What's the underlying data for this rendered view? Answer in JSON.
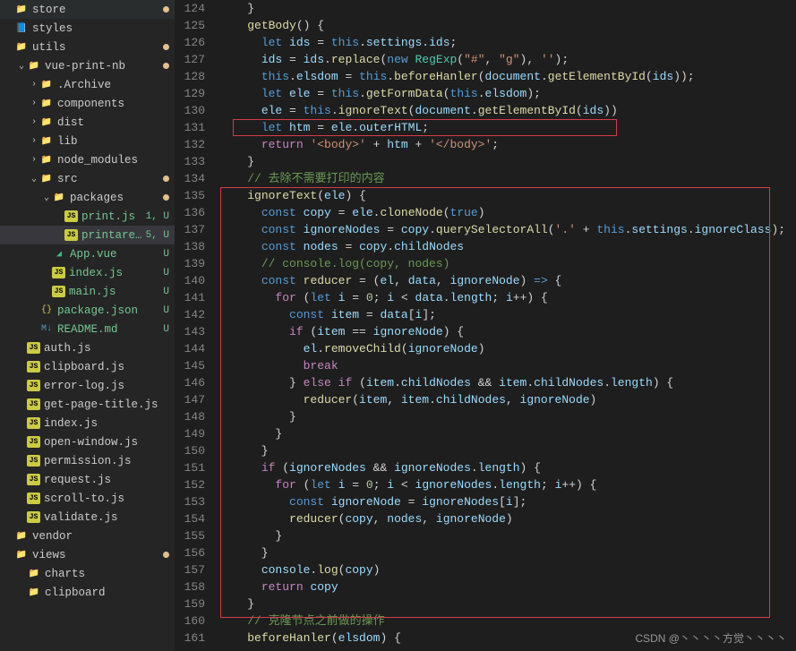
{
  "sidebar": [
    {
      "indent": 0,
      "chev": "",
      "icon": "folder",
      "iconClass": "folder-icon",
      "label": "store",
      "dot": true,
      "name": "folder-store"
    },
    {
      "indent": 0,
      "chev": "",
      "icon": "styles",
      "iconClass": "folder-blue",
      "label": "styles",
      "name": "folder-styles"
    },
    {
      "indent": 0,
      "chev": "",
      "icon": "folder",
      "iconClass": "folder-red",
      "label": "utils",
      "dot": true,
      "name": "folder-utils"
    },
    {
      "indent": 1,
      "chev": "v",
      "icon": "folder",
      "iconClass": "folder-orange",
      "label": "vue-print-nb",
      "dot": true,
      "name": "folder-vue-print-nb"
    },
    {
      "indent": 2,
      "chev": ">",
      "icon": "folder",
      "iconClass": "folder-icon",
      "label": ".Archive",
      "name": "folder-archive"
    },
    {
      "indent": 2,
      "chev": ">",
      "icon": "folder",
      "iconClass": "folder-green",
      "label": "components",
      "name": "folder-components"
    },
    {
      "indent": 2,
      "chev": ">",
      "icon": "folder",
      "iconClass": "folder-icon",
      "label": "dist",
      "name": "folder-dist"
    },
    {
      "indent": 2,
      "chev": ">",
      "icon": "folder",
      "iconClass": "folder-icon",
      "label": "lib",
      "name": "folder-lib"
    },
    {
      "indent": 2,
      "chev": ">",
      "icon": "folder",
      "iconClass": "folder-green",
      "label": "node_modules",
      "name": "folder-node-modules"
    },
    {
      "indent": 2,
      "chev": "v",
      "icon": "folder",
      "iconClass": "folder-green",
      "label": "src",
      "dot": true,
      "name": "folder-src"
    },
    {
      "indent": 3,
      "chev": "v",
      "icon": "folder",
      "iconClass": "folder-orange",
      "label": "packages",
      "dot": true,
      "name": "folder-packages"
    },
    {
      "indent": 4,
      "chev": "",
      "icon": "JS",
      "iconClass": "js-icon",
      "label": "print.js",
      "status": "1, U",
      "statusClass": "u",
      "name": "file-print-js"
    },
    {
      "indent": 4,
      "chev": "",
      "icon": "JS",
      "iconClass": "js-icon",
      "label": "printarea.js",
      "status": "5, U",
      "statusClass": "u",
      "active": true,
      "name": "file-printarea-js"
    },
    {
      "indent": 3,
      "chev": "",
      "icon": "V",
      "iconClass": "vue-icon",
      "label": "App.vue",
      "status": "U",
      "statusClass": "u",
      "name": "file-app-vue"
    },
    {
      "indent": 3,
      "chev": "",
      "icon": "JS",
      "iconClass": "js-icon",
      "label": "index.js",
      "status": "U",
      "statusClass": "u",
      "name": "file-index-js"
    },
    {
      "indent": 3,
      "chev": "",
      "icon": "JS",
      "iconClass": "js-icon",
      "label": "main.js",
      "status": "U",
      "statusClass": "u",
      "name": "file-main-js"
    },
    {
      "indent": 2,
      "chev": "",
      "icon": "{}",
      "iconClass": "json-icon",
      "label": "package.json",
      "status": "U",
      "statusClass": "u",
      "name": "file-package-json"
    },
    {
      "indent": 2,
      "chev": "",
      "icon": "M↓",
      "iconClass": "md-icon",
      "label": "README.md",
      "status": "U",
      "statusClass": "u",
      "name": "file-readme-md"
    },
    {
      "indent": 1,
      "chev": "",
      "icon": "JS",
      "iconClass": "js-icon",
      "label": "auth.js",
      "name": "file-auth-js"
    },
    {
      "indent": 1,
      "chev": "",
      "icon": "JS",
      "iconClass": "js-icon",
      "label": "clipboard.js",
      "name": "file-clipboard-js"
    },
    {
      "indent": 1,
      "chev": "",
      "icon": "JS",
      "iconClass": "js-icon",
      "label": "error-log.js",
      "name": "file-error-log-js"
    },
    {
      "indent": 1,
      "chev": "",
      "icon": "JS",
      "iconClass": "js-icon",
      "label": "get-page-title.js",
      "name": "file-get-page-title-js"
    },
    {
      "indent": 1,
      "chev": "",
      "icon": "JS",
      "iconClass": "js-icon",
      "label": "index.js",
      "name": "file-utils-index-js"
    },
    {
      "indent": 1,
      "chev": "",
      "icon": "JS",
      "iconClass": "js-icon",
      "label": "open-window.js",
      "name": "file-open-window-js"
    },
    {
      "indent": 1,
      "chev": "",
      "icon": "JS",
      "iconClass": "js-icon",
      "label": "permission.js",
      "name": "file-permission-js"
    },
    {
      "indent": 1,
      "chev": "",
      "icon": "JS",
      "iconClass": "js-icon",
      "label": "request.js",
      "name": "file-request-js"
    },
    {
      "indent": 1,
      "chev": "",
      "icon": "JS",
      "iconClass": "js-icon",
      "label": "scroll-to.js",
      "name": "file-scroll-to-js"
    },
    {
      "indent": 1,
      "chev": "",
      "icon": "JS",
      "iconClass": "js-icon",
      "label": "validate.js",
      "name": "file-validate-js"
    },
    {
      "indent": 0,
      "chev": "",
      "icon": "folder",
      "iconClass": "folder-icon",
      "label": "vendor",
      "name": "folder-vendor"
    },
    {
      "indent": 0,
      "chev": "",
      "icon": "folder",
      "iconClass": "folder-red",
      "label": "views",
      "dot": true,
      "name": "folder-views"
    },
    {
      "indent": 1,
      "chev": "",
      "icon": "folder",
      "iconClass": "folder-icon",
      "label": "charts",
      "name": "folder-charts"
    },
    {
      "indent": 1,
      "chev": "",
      "icon": "folder",
      "iconClass": "folder-icon",
      "label": "clipboard",
      "name": "folder-clipboard"
    }
  ],
  "codeLines": [
    {
      "n": 124,
      "html": "    }"
    },
    {
      "n": 125,
      "html": "    <span class='fn'>getBody</span>() {"
    },
    {
      "n": 126,
      "html": "      <span class='kw2'>let</span> <span class='var'>ids</span> = <span class='kw2'>this</span>.<span class='prop'>settings</span>.<span class='prop'>ids</span>;"
    },
    {
      "n": 127,
      "html": "      <span class='var'>ids</span> = <span class='var'>ids</span>.<span class='fn'>replace</span>(<span class='kw2'>new</span> <span class='cls'>RegExp</span>(<span class='str'>\"#\"</span>, <span class='str'>\"g\"</span>), <span class='str'>''</span>);"
    },
    {
      "n": 128,
      "html": "      <span class='kw2'>this</span>.<span class='prop'>elsdom</span> = <span class='kw2'>this</span>.<span class='fn'>beforeHanler</span>(<span class='var'>document</span>.<span class='fn'>getElementById</span>(<span class='var'>ids</span>));"
    },
    {
      "n": 129,
      "html": "      <span class='kw2'>let</span> <span class='var'>ele</span> = <span class='kw2'>this</span>.<span class='fn'>getFormData</span>(<span class='kw2'>this</span>.<span class='prop'>elsdom</span>);"
    },
    {
      "n": 130,
      "html": "      <span class='var'>ele</span> = <span class='kw2'>this</span>.<span class='fn'>ignoreText</span>(<span class='var'>document</span>.<span class='fn'>getElementById</span>(<span class='var'>ids</span>))"
    },
    {
      "n": 131,
      "html": "      <span class='kw2'>let</span> <span class='var'>htm</span> = <span class='var'>ele</span>.<span class='prop'>outerHTML</span>;"
    },
    {
      "n": 132,
      "html": "      <span class='kw'>return</span> <span class='str'>'&lt;body&gt;'</span> + <span class='var'>htm</span> + <span class='str'>'&lt;/body&gt;'</span>;"
    },
    {
      "n": 133,
      "html": "    }"
    },
    {
      "n": 134,
      "html": "    <span class='cmt'>// 去除不需要打印的内容</span>"
    },
    {
      "n": 135,
      "html": "    <span class='fn'>ignoreText</span>(<span class='var'>ele</span>) {"
    },
    {
      "n": 136,
      "html": "      <span class='kw2'>const</span> <span class='var'>copy</span> = <span class='var'>ele</span>.<span class='fn'>cloneNode</span>(<span class='kw2'>true</span>)"
    },
    {
      "n": 137,
      "html": "      <span class='kw2'>const</span> <span class='var'>ignoreNodes</span> = <span class='var'>copy</span>.<span class='fn'>querySelectorAll</span>(<span class='str'>'.'</span> + <span class='kw2'>this</span>.<span class='prop'>settings</span>.<span class='prop'>ignoreClass</span>);"
    },
    {
      "n": 138,
      "html": "      <span class='kw2'>const</span> <span class='var'>nodes</span> = <span class='var'>copy</span>.<span class='prop'>childNodes</span>"
    },
    {
      "n": 139,
      "html": "      <span class='cmt'>// console.log(copy, nodes)</span>"
    },
    {
      "n": 140,
      "html": "      <span class='kw2'>const</span> <span class='fn'>reducer</span> = (<span class='var'>el</span>, <span class='var'>data</span>, <span class='var'>ignoreNode</span>) <span class='kw2'>=&gt;</span> {"
    },
    {
      "n": 141,
      "html": "        <span class='kw'>for</span> (<span class='kw2'>let</span> <span class='var'>i</span> = <span class='num'>0</span>; <span class='var'>i</span> &lt; <span class='var'>data</span>.<span class='prop'>length</span>; <span class='var'>i</span>++) {"
    },
    {
      "n": 142,
      "html": "          <span class='kw2'>const</span> <span class='var'>item</span> = <span class='var'>data</span>[<span class='var'>i</span>];"
    },
    {
      "n": 143,
      "html": "          <span class='kw'>if</span> (<span class='var'>item</span> == <span class='var'>ignoreNode</span>) {"
    },
    {
      "n": 144,
      "html": "            <span class='var'>el</span>.<span class='fn'>removeChild</span>(<span class='var'>ignoreNode</span>)"
    },
    {
      "n": 145,
      "html": "            <span class='kw'>break</span>"
    },
    {
      "n": 146,
      "html": "          } <span class='kw'>else</span> <span class='kw'>if</span> (<span class='var'>item</span>.<span class='prop'>childNodes</span> && <span class='var'>item</span>.<span class='prop'>childNodes</span>.<span class='prop'>length</span>) {"
    },
    {
      "n": 147,
      "html": "            <span class='fn'>reducer</span>(<span class='var'>item</span>, <span class='var'>item</span>.<span class='prop'>childNodes</span>, <span class='var'>ignoreNode</span>)"
    },
    {
      "n": 148,
      "html": "          }"
    },
    {
      "n": 149,
      "html": "        }"
    },
    {
      "n": 150,
      "html": "      }"
    },
    {
      "n": 151,
      "html": "      <span class='kw'>if</span> (<span class='var'>ignoreNodes</span> && <span class='var'>ignoreNodes</span>.<span class='prop'>length</span>) {"
    },
    {
      "n": 152,
      "html": "        <span class='kw'>for</span> (<span class='kw2'>let</span> <span class='var'>i</span> = <span class='num'>0</span>; <span class='var'>i</span> &lt; <span class='var'>ignoreNodes</span>.<span class='prop'>length</span>; <span class='var'>i</span>++) {"
    },
    {
      "n": 153,
      "html": "          <span class='kw2'>const</span> <span class='var'>ignoreNode</span> = <span class='var'>ignoreNodes</span>[<span class='var'>i</span>];"
    },
    {
      "n": 154,
      "html": "          <span class='fn'>reducer</span>(<span class='var'>copy</span>, <span class='var'>nodes</span>, <span class='var'>ignoreNode</span>)"
    },
    {
      "n": 155,
      "html": "        }"
    },
    {
      "n": 156,
      "html": "      }"
    },
    {
      "n": 157,
      "html": "      <span class='var'>console</span>.<span class='fn'>log</span>(<span class='var'>copy</span>)"
    },
    {
      "n": 158,
      "html": "      <span class='kw'>return</span> <span class='var'>copy</span>"
    },
    {
      "n": 159,
      "html": "    }"
    },
    {
      "n": 160,
      "html": "    <span class='cmt'>// 克隆节点之前做的操作</span>"
    },
    {
      "n": 161,
      "html": "    <span class='fn'>beforeHanler</span>(<span class='var'>elsdom</span>) {"
    }
  ],
  "watermark": "CSDN @丶丶丶丶方觉丶丶丶丶"
}
